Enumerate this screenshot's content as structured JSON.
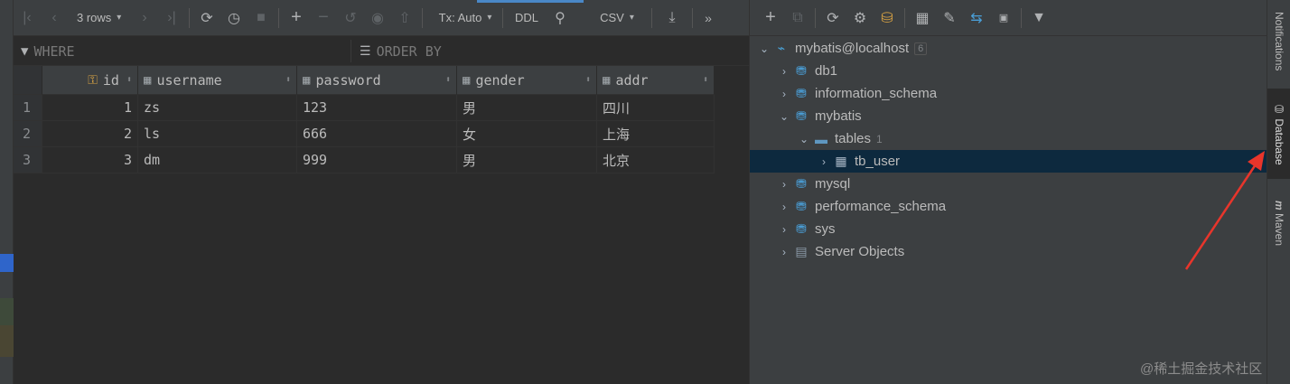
{
  "toolbar": {
    "rows_label": "3 rows",
    "tx_label": "Tx: Auto",
    "ddl_label": "DDL",
    "csv_label": "CSV",
    "more_label": "»"
  },
  "filter": {
    "where_label": "WHERE",
    "order_label": "ORDER BY"
  },
  "grid": {
    "columns": [
      "id",
      "username",
      "password",
      "gender",
      "addr"
    ],
    "rows": [
      {
        "n": "1",
        "id": "1",
        "username": "zs",
        "password": "123",
        "gender": "男",
        "addr": "四川"
      },
      {
        "n": "2",
        "id": "2",
        "username": "ls",
        "password": "666",
        "gender": "女",
        "addr": "上海"
      },
      {
        "n": "3",
        "id": "3",
        "username": "dm",
        "password": "999",
        "gender": "男",
        "addr": "北京"
      }
    ]
  },
  "tree": {
    "root": {
      "label": "mybatis@localhost",
      "count": "6"
    },
    "items": [
      {
        "label": "db1"
      },
      {
        "label": "information_schema"
      },
      {
        "label": "mybatis"
      },
      {
        "label": "tables",
        "count": "1"
      },
      {
        "label": "tb_user"
      },
      {
        "label": "mysql"
      },
      {
        "label": "performance_schema"
      },
      {
        "label": "sys"
      },
      {
        "label": "Server Objects"
      }
    ]
  },
  "side_tabs": {
    "notifications": "Notifications",
    "database": "Database",
    "maven": "Maven"
  },
  "watermark": "@稀土掘金技术社区",
  "colors": {
    "selection": "#0d293e",
    "accent": "#4a88c7",
    "arrow": "#e8352b"
  }
}
